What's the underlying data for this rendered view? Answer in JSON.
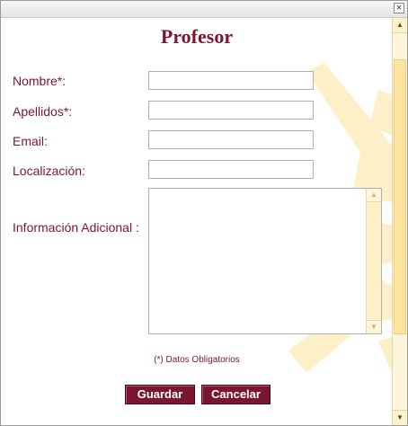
{
  "window": {
    "close_symbol": "×"
  },
  "form": {
    "title": "Profesor",
    "fields": [
      {
        "label": "Nombre*:",
        "value": ""
      },
      {
        "label": "Apellidos*:",
        "value": ""
      },
      {
        "label": "Email:",
        "value": ""
      },
      {
        "label": "Localización:",
        "value": ""
      }
    ],
    "textarea": {
      "label": "Información Adicional :",
      "value": ""
    },
    "required_note": "(*) Datos Obligatorios",
    "save_label": "Guardar",
    "cancel_label": "Cancelar"
  },
  "colors": {
    "accent": "#7a1630",
    "scrollbar": "#fde4a0",
    "background_art": "#fdf0c8"
  }
}
